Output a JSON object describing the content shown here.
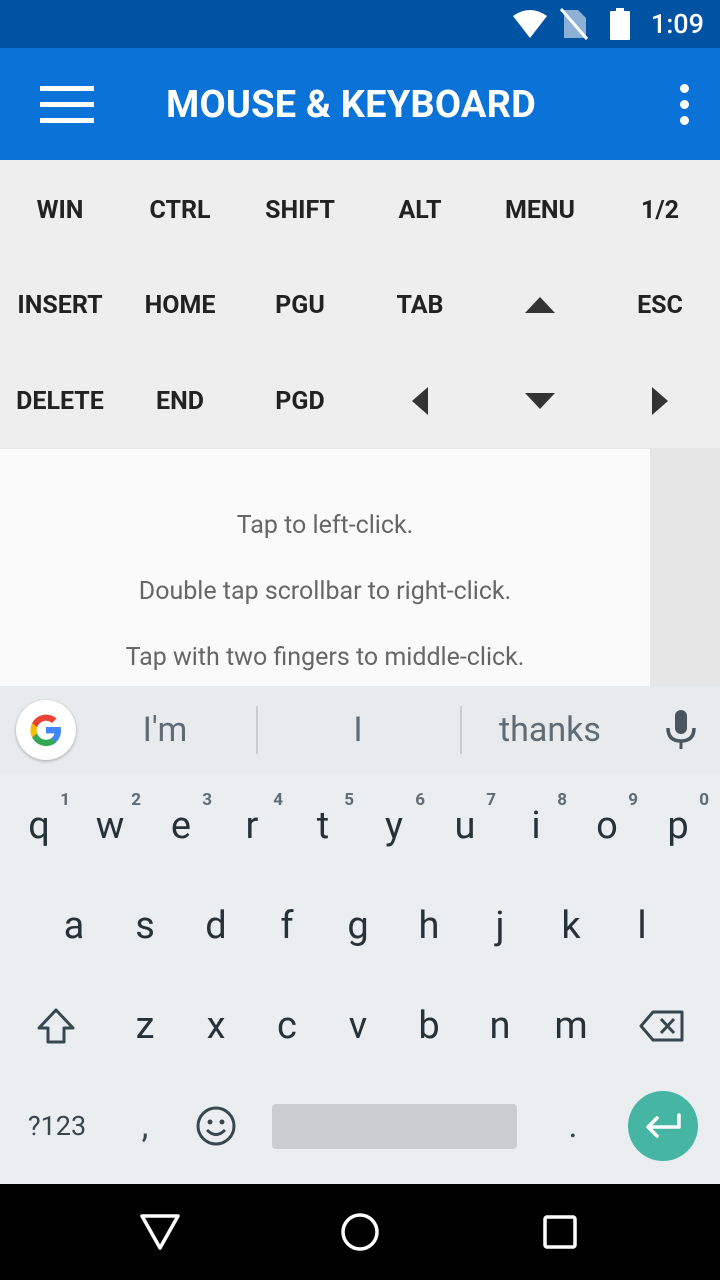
{
  "status_bar": {
    "time": "1:09",
    "icons": [
      "wifi-icon",
      "no-sim-icon",
      "battery-icon"
    ]
  },
  "app_bar": {
    "title": "MOUSE & KEYBOARD",
    "menu_icon": "hamburger-menu-icon",
    "overflow_icon": "more-vertical-icon"
  },
  "special_keys": {
    "row1": [
      "WIN",
      "CTRL",
      "SHIFT",
      "ALT",
      "MENU",
      "1/2"
    ],
    "row2": [
      "INSERT",
      "HOME",
      "PGU",
      "TAB",
      "ESC"
    ],
    "row3": [
      "DELETE",
      "END",
      "PGD"
    ],
    "arrow_icons": [
      "arrow-up-icon",
      "arrow-left-icon",
      "arrow-down-icon",
      "arrow-right-icon"
    ]
  },
  "touchpad": {
    "hints": [
      "Tap to left-click.",
      "Double tap scrollbar to right-click.",
      "Tap with two fingers to middle-click."
    ]
  },
  "keyboard": {
    "suggestions": [
      "I'm",
      "I",
      "thanks"
    ],
    "row1": [
      {
        "key": "q",
        "hint": "1"
      },
      {
        "key": "w",
        "hint": "2"
      },
      {
        "key": "e",
        "hint": "3"
      },
      {
        "key": "r",
        "hint": "4"
      },
      {
        "key": "t",
        "hint": "5"
      },
      {
        "key": "y",
        "hint": "6"
      },
      {
        "key": "u",
        "hint": "7"
      },
      {
        "key": "i",
        "hint": "8"
      },
      {
        "key": "o",
        "hint": "9"
      },
      {
        "key": "p",
        "hint": "0"
      }
    ],
    "row2": [
      "a",
      "s",
      "d",
      "f",
      "g",
      "h",
      "j",
      "k",
      "l"
    ],
    "row3": [
      "z",
      "x",
      "c",
      "v",
      "b",
      "n",
      "m"
    ],
    "symbols_label": "?123",
    "comma": ",",
    "period": ".",
    "enter_color": "#47b5a4"
  },
  "nav_bar": {
    "icons": [
      "back-icon",
      "home-icon",
      "recents-icon"
    ]
  },
  "colors": {
    "status_bar": "#0053a3",
    "app_bar": "#0b72d8"
  }
}
